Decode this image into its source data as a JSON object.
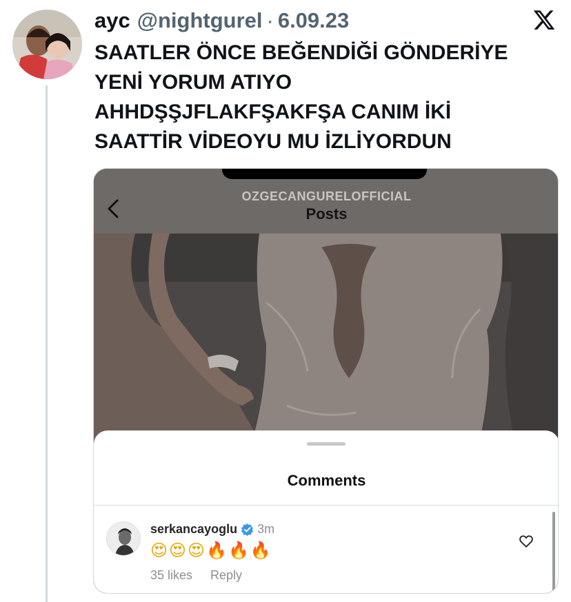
{
  "tweet": {
    "author_name": "ayc",
    "author_handle": "@nightgurel",
    "separator": "·",
    "date": "6.09.23",
    "text_lines": [
      "SAATLER ÖNCE BEĞENDİĞİ GÖNDERİYE",
      "YENİ YORUM ATIYO",
      "AHHDŞŞJFLAKFŞAKFŞA CANIM İKİ",
      "SAATTİR VİDEOYU MU İZLİYORDUN"
    ]
  },
  "embedded_screenshot": {
    "account_name": "OZGECANGURELOFFICIAL",
    "page_title": "Posts",
    "comments_title": "Comments",
    "comment": {
      "username": "serkancayoglu",
      "time": "3m",
      "text": "😍😍😍🔥🔥🔥",
      "likes": "35 likes",
      "reply_label": "Reply"
    }
  },
  "icons": {
    "x_logo": "x-logo-icon",
    "back": "chevron-left-icon",
    "verified": "verified-badge-icon",
    "like": "heart-outline-icon"
  },
  "colors": {
    "verified_blue": "#3897f0",
    "secondary_text": "#536471",
    "ig_header_overlay": "#6e6a67"
  }
}
